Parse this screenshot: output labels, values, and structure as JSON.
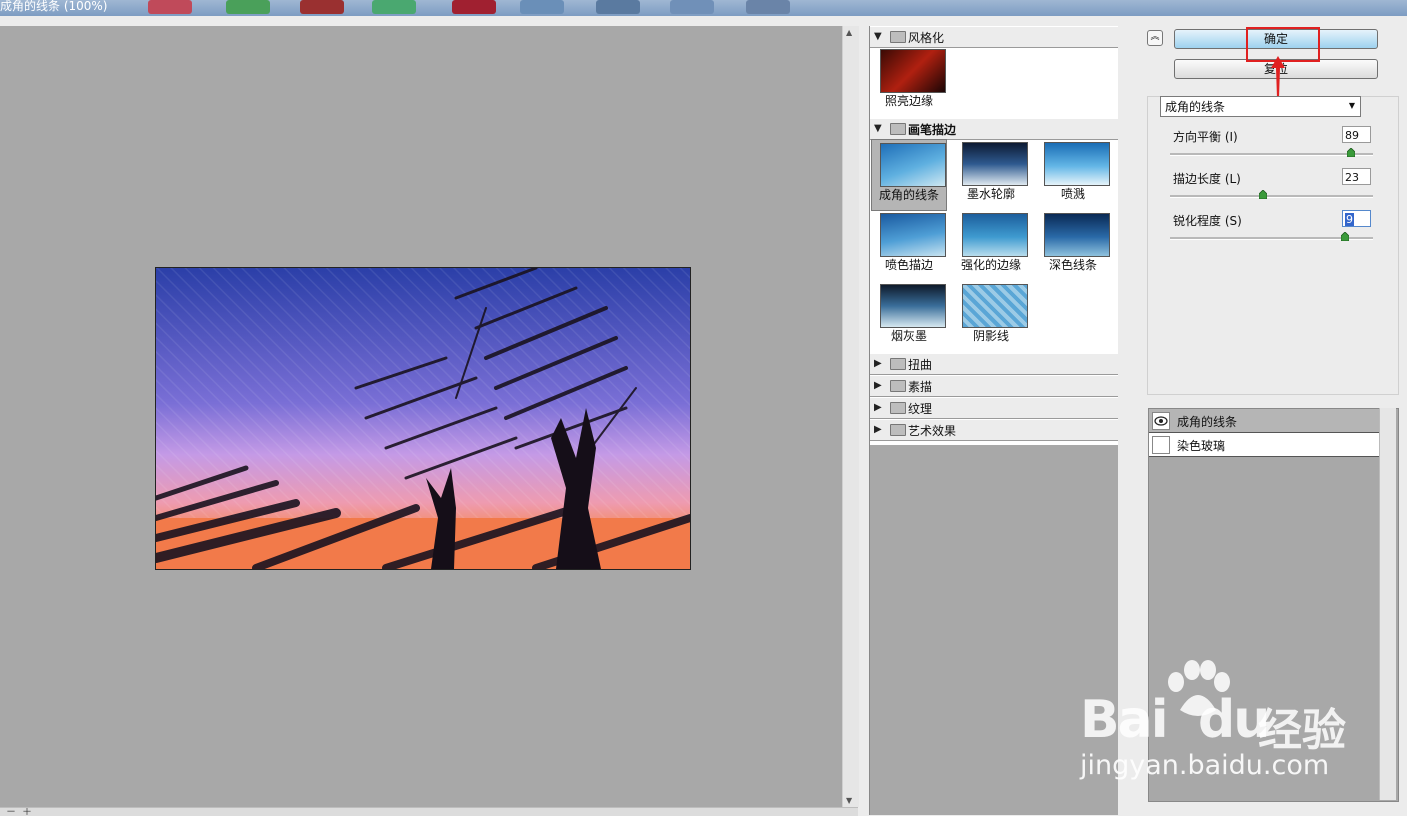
{
  "window": {
    "title": "成角的线条 (100%)"
  },
  "gallery": {
    "categories": [
      {
        "label": "风格化",
        "expanded": true,
        "filters": [
          "照亮边缘"
        ]
      },
      {
        "label": "画笔描边",
        "expanded": true,
        "filters": [
          "成角的线条",
          "墨水轮廓",
          "喷溅",
          "喷色描边",
          "强化的边缘",
          "深色线条",
          "烟灰墨",
          "阴影线"
        ]
      },
      {
        "label": "扭曲",
        "expanded": false
      },
      {
        "label": "素描",
        "expanded": false
      },
      {
        "label": "纹理",
        "expanded": false
      },
      {
        "label": "艺术效果",
        "expanded": false
      }
    ],
    "selected_filter": "成角的线条"
  },
  "buttons": {
    "ok_label": "确定",
    "reset_label": "复位"
  },
  "settings": {
    "filter_select_value": "成角的线条",
    "params": [
      {
        "label": "方向平衡 (I)",
        "value": "89",
        "slider_fraction": 0.89
      },
      {
        "label": "描边长度 (L)",
        "value": "23",
        "slider_fraction": 0.46
      },
      {
        "label": "锐化程度 (S)",
        "value": "9",
        "slider_fraction": 0.86
      }
    ]
  },
  "layers": [
    {
      "label": "成角的线条",
      "visible": true,
      "selected": true
    },
    {
      "label": "染色玻璃",
      "visible": false,
      "selected": false
    }
  ],
  "watermark": {
    "brand_prefix": "Bai",
    "brand_suffix": "du",
    "brand_cn": "经验",
    "url": "jingyan.baidu.com"
  },
  "colors": {
    "highlight_box": "#e02020",
    "ok_button": "#9ed2ef"
  }
}
